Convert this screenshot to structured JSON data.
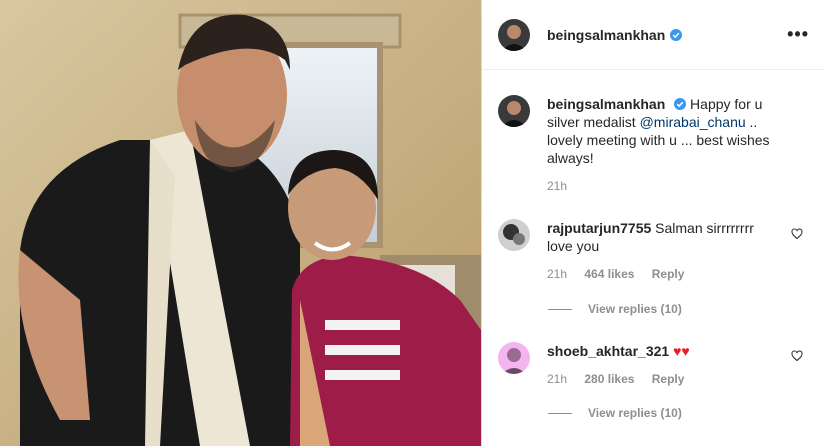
{
  "header": {
    "username": "beingsalmankhan"
  },
  "caption": {
    "username": "beingsalmankhan",
    "text_before": "Happy for u silver medalist",
    "mention": "@mirabai_chanu",
    "text_after": ".. lovely meeting with u ... best wishes always!",
    "time": "21h"
  },
  "comments": [
    {
      "username": "rajputarjun7755",
      "text": "Salman sirrrrrrrr love you",
      "time": "21h",
      "likes": "464 likes",
      "reply_label": "Reply",
      "view_replies": "View replies (10)"
    },
    {
      "username": "shoeb_akhtar_321",
      "text": "♥♥",
      "time": "21h",
      "likes": "280 likes",
      "reply_label": "Reply",
      "view_replies": "View replies (10)"
    }
  ],
  "colors": {
    "verified": "#3897f0",
    "mention": "#00376b",
    "muted": "#8e8e8e",
    "heart_emoji": "#ed1c24"
  },
  "icons": [
    "verified-badge-icon",
    "more-options-icon",
    "like-heart-icon"
  ]
}
